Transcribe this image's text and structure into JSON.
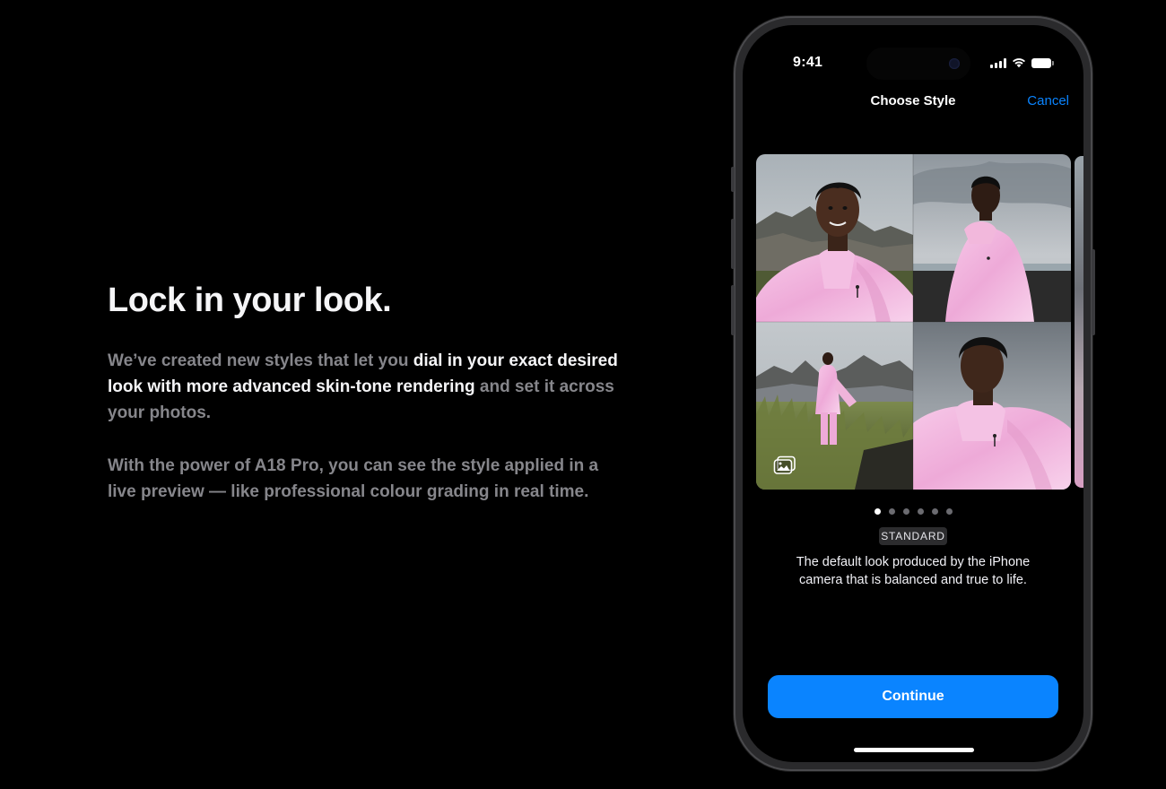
{
  "copy": {
    "headline": "Lock in your look.",
    "p1_a": "We’ve created new styles that let you ",
    "p1_b": "dial in your exact desired look with more advanced skin-tone rendering",
    "p1_c": " and set it across your photos.",
    "p2": "With the power of A18 Pro, you can see the style applied in a live preview — like professional colour grading in real time."
  },
  "phone": {
    "status": {
      "time": "9:41"
    },
    "nav": {
      "title": "Choose Style",
      "cancel_label": "Cancel"
    },
    "gallery": {
      "dots_total": 6,
      "active_dot": 1
    },
    "style": {
      "name": "STANDARD",
      "description": "The default look produced by the iPhone camera that is balanced and true to life."
    },
    "continue_label": "Continue"
  },
  "colors": {
    "accent": "#0a84ff",
    "background": "#000000",
    "headline": "#f5f5f7",
    "muted_text": "#86868b",
    "jacket_pink": "#f2b6df"
  },
  "icons": {
    "gallery": "photo-gallery-icon",
    "signal": "cellular-signal-icon",
    "wifi": "wifi-icon",
    "battery": "battery-icon"
  }
}
